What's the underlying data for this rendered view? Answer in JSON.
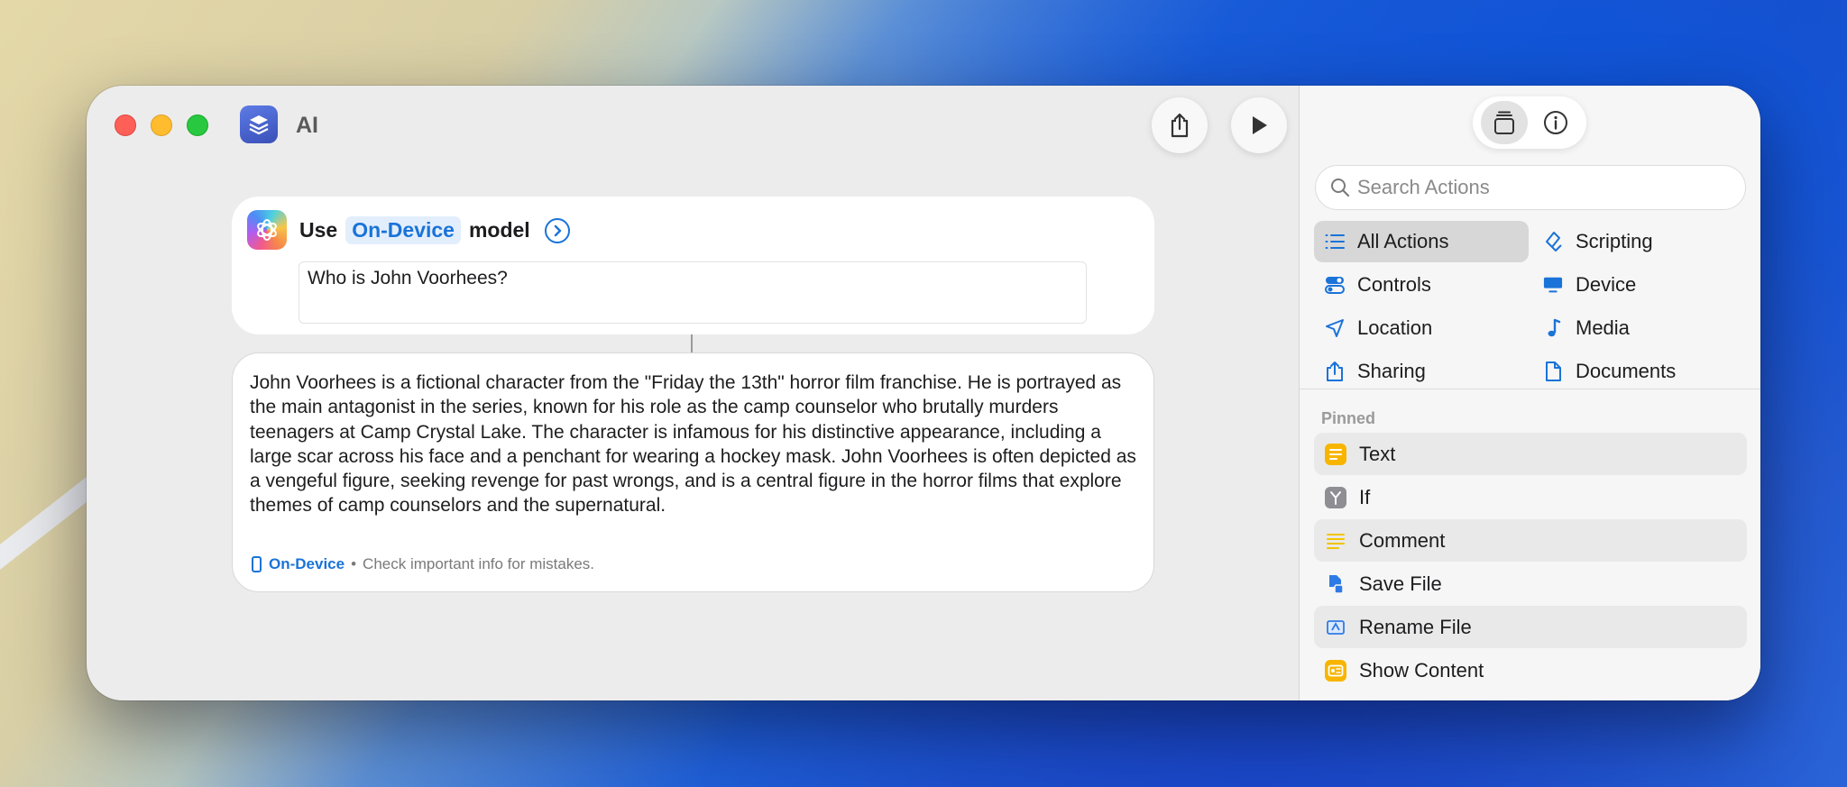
{
  "window": {
    "title": "AI"
  },
  "toolbar": {
    "share_icon": "share-icon",
    "run_icon": "play-icon"
  },
  "action": {
    "verb": "Use",
    "model": "On-Device",
    "suffix": "model",
    "prompt": "Who is John Voorhees?"
  },
  "response": {
    "text": "John Voorhees is a fictional character from the \"Friday the 13th\" horror film franchise. He is portrayed as the main antagonist in the series, known for his role as the camp counselor who brutally murders teenagers at Camp Crystal Lake. The character is infamous for his distinctive appearance, including a large scar across his face and a penchant for wearing a hockey mask. John Voorhees is often depicted as a vengeful figure, seeking revenge for past wrongs, and is a central figure in the horror films that explore themes of camp counselors and the supernatural.",
    "badge": "On-Device",
    "separator": "•",
    "disclaimer": "Check important info for mistakes."
  },
  "sidebar": {
    "search_placeholder": "Search Actions",
    "categories": [
      {
        "label": "All Actions",
        "icon": "list-icon"
      },
      {
        "label": "Scripting",
        "icon": "scripting-icon"
      },
      {
        "label": "Controls",
        "icon": "toggle-icon"
      },
      {
        "label": "Device",
        "icon": "display-icon"
      },
      {
        "label": "Location",
        "icon": "location-arrow-icon"
      },
      {
        "label": "Media",
        "icon": "music-note-icon"
      },
      {
        "label": "Sharing",
        "icon": "share-icon"
      },
      {
        "label": "Documents",
        "icon": "document-icon"
      }
    ],
    "pinned_label": "Pinned",
    "pinned": [
      {
        "label": "Text",
        "icon": "text-icon",
        "color": "#f7b500"
      },
      {
        "label": "If",
        "icon": "branch-icon",
        "color": "#8e8e93"
      },
      {
        "label": "Comment",
        "icon": "comment-lines-icon",
        "color": "#f2c400"
      },
      {
        "label": "Save File",
        "icon": "save-file-icon",
        "color": "#2f7be5"
      },
      {
        "label": "Rename File",
        "icon": "rename-file-icon",
        "color": "#2f7be5"
      },
      {
        "label": "Show Content",
        "icon": "show-content-icon",
        "color": "#f7b500"
      }
    ]
  },
  "colors": {
    "accent": "#1a73d8",
    "token_bg": "#e3eefc"
  }
}
